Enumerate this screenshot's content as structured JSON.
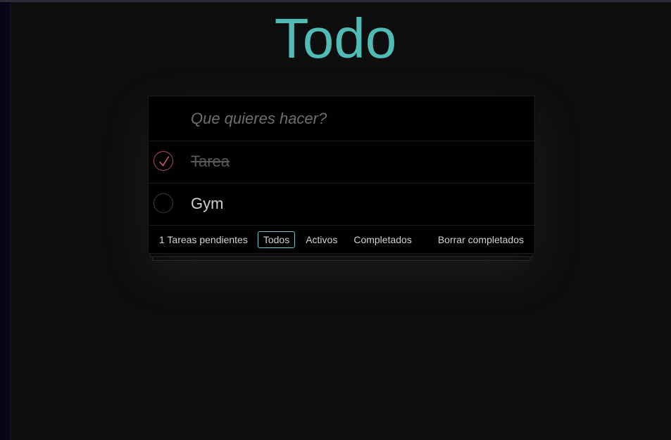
{
  "app": {
    "title": "Todo"
  },
  "input": {
    "placeholder": "Que quieres hacer?",
    "value": ""
  },
  "todos": [
    {
      "text": "Tarea",
      "completed": true
    },
    {
      "text": "Gym",
      "completed": false
    }
  ],
  "footer": {
    "count_text": "1 Tareas pendientes",
    "filters": [
      {
        "label": "Todos",
        "selected": true
      },
      {
        "label": "Activos",
        "selected": false
      },
      {
        "label": "Completados",
        "selected": false
      }
    ],
    "clear_label": "Borrar completados"
  },
  "colors": {
    "accent": "#4fbdb5",
    "check": "#b0485a",
    "background": "#0e0e0e"
  }
}
